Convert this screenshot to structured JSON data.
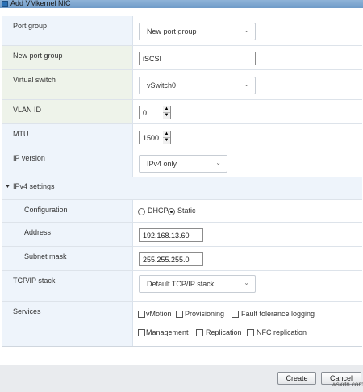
{
  "dialog": {
    "title": "Add VMkernel NIC"
  },
  "form": {
    "port_group": {
      "label": "Port group",
      "value": "New port group"
    },
    "new_port_group": {
      "label": "New port group",
      "value": "iSCSI"
    },
    "virtual_switch": {
      "label": "Virtual switch",
      "value": "vSwitch0"
    },
    "vlan_id": {
      "label": "VLAN ID",
      "value": "0"
    },
    "mtu": {
      "label": "MTU",
      "value": "1500"
    },
    "ip_version": {
      "label": "IP version",
      "value": "IPv4 only"
    },
    "ipv4_settings": {
      "label": "IPv4 settings",
      "configuration": {
        "label": "Configuration",
        "options": [
          "DHCP",
          "Static"
        ],
        "selected": "Static"
      },
      "address": {
        "label": "Address",
        "value": "192.168.13.60"
      },
      "subnet_mask": {
        "label": "Subnet mask",
        "value": "255.255.255.0"
      }
    },
    "tcpip_stack": {
      "label": "TCP/IP stack",
      "value": "Default TCP/IP stack"
    },
    "services": {
      "label": "Services",
      "options": [
        "vMotion",
        "Provisioning",
        "Fault tolerance logging",
        "Management",
        "Replication",
        "NFC replication"
      ],
      "checked": []
    }
  },
  "buttons": {
    "create": "Create",
    "cancel": "Cancel"
  },
  "watermark": "wsxdn.com"
}
